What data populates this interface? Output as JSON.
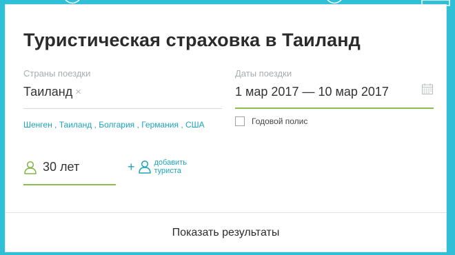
{
  "page": {
    "title": "Туристическая страховка в Таиланд"
  },
  "countries": {
    "label": "Страны поездки",
    "selected": "Таиланд",
    "remove_glyph": "×",
    "suggestions": [
      "Шенген",
      "Таиланд",
      "Болгария",
      "Германия",
      "США"
    ]
  },
  "dates": {
    "label": "Даты поездки",
    "value": "1 мар 2017 — 10 мар 2017"
  },
  "annual_policy": {
    "label": "Годовой полис",
    "checked": false
  },
  "traveler": {
    "age": "30 лет"
  },
  "add_traveler": {
    "line1": "добавить",
    "line2": "туриста"
  },
  "results_button": {
    "label": "Показать результаты"
  },
  "colors": {
    "accent_link": "#1aa4bd",
    "active_underline": "#8bbd4a",
    "background": "#2fc0d7"
  }
}
